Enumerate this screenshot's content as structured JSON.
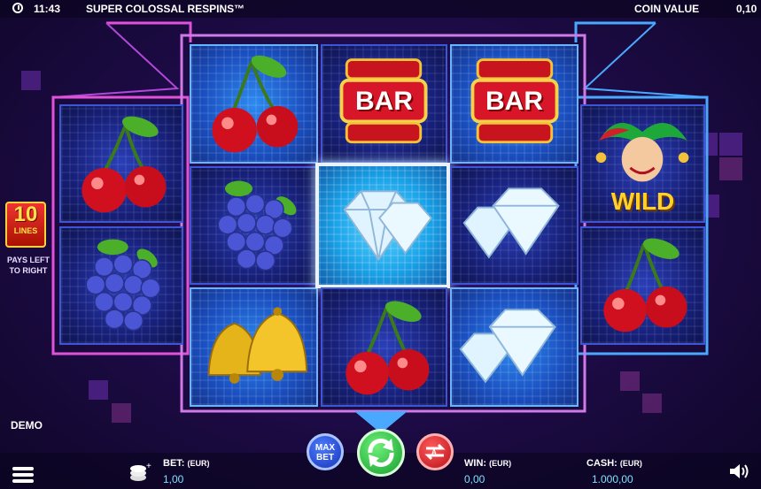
{
  "status_bar": {
    "time": "11:43",
    "game_title": "SUPER COLOSSAL RESPINS™",
    "coin_value_label": "COIN VALUE",
    "coin_value": "0,10"
  },
  "paylines": {
    "count": "10",
    "label": "LINES",
    "note_line1": "PAYS LEFT",
    "note_line2": "TO RIGHT"
  },
  "mode": "DEMO",
  "reels": {
    "symbols": [
      [
        "cherry",
        "grapes"
      ],
      [
        "cherry",
        "grapes",
        "bell"
      ],
      [
        "bar",
        "diamond",
        "cherry"
      ],
      [
        "bar",
        "diamond",
        "diamond"
      ],
      [
        "wild",
        "cherry"
      ]
    ],
    "bar_text": "BAR",
    "wild_text": "WILD"
  },
  "controls": {
    "max_bet_line1": "MAX",
    "max_bet_line2": "BET",
    "bet_label": "BET:",
    "bet_currency": "(EUR)",
    "bet_value": "1,00",
    "win_label": "WIN:",
    "win_currency": "(EUR)",
    "win_value": "0,00",
    "cash_label": "CASH:",
    "cash_currency": "(EUR)",
    "cash_value": "1.000,00"
  },
  "colors": {
    "background": "#1f0c4a",
    "frame_pink": "#e052d8",
    "frame_blue": "#4aa8ff",
    "spin_button": "#1fbe3a",
    "auto_button": "#e0202a",
    "max_bet_button": "#2446d8",
    "value_text": "#7fe0ff"
  }
}
